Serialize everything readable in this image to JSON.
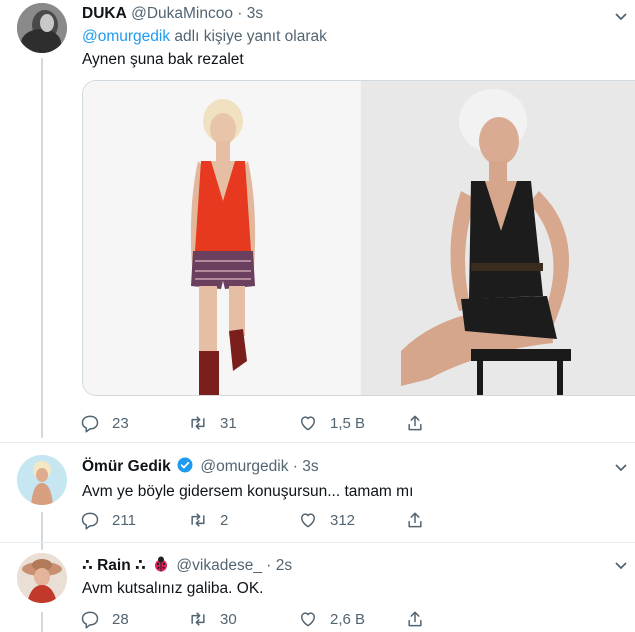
{
  "tweets": [
    {
      "name": "DUKA",
      "handle": "@DukaMincoo",
      "dot": "·",
      "time": "3s",
      "reply_prefix": "",
      "reply_mention": "@omurgedik",
      "reply_suffix": " adlı kişiye yanıt olarak",
      "text": "Aynen şuna bak rezalet",
      "replies": "23",
      "retweets": "31",
      "likes": "1,5 B"
    },
    {
      "name": "Ömür Gedik",
      "handle": "@omurgedik",
      "dot": "·",
      "time": "3s",
      "text": "Avm ye böyle gidersem konuşursun... tamam mı",
      "replies": "211",
      "retweets": "2",
      "likes": "312"
    },
    {
      "name": "∴ Rain ∴",
      "handle": "@vikadese_",
      "dot": "·",
      "time": "2s",
      "text": "Avm kutsalınız galiba. OK.",
      "replies": "28",
      "retweets": "30",
      "likes": "2,6 B"
    }
  ],
  "colors": {
    "accent": "#1d9bf0",
    "muted": "#536471",
    "verified": "#1d9bf0"
  },
  "icons": [
    "reply-icon",
    "retweet-icon",
    "like-icon",
    "share-icon",
    "chevron-down-icon",
    "verified-badge-icon",
    "ladybug-emoji-icon"
  ]
}
